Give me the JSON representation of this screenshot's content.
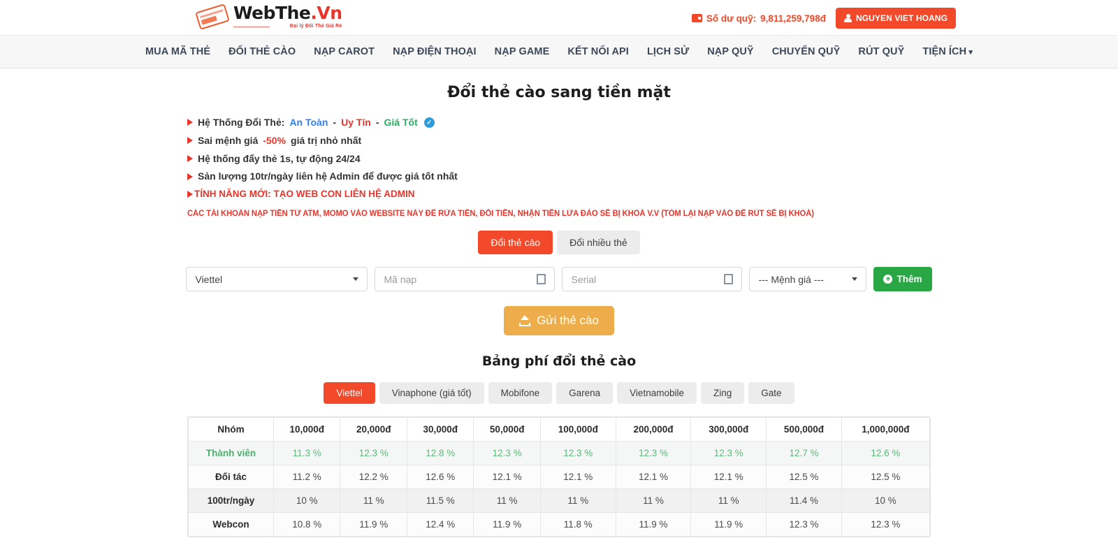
{
  "header": {
    "logo": {
      "main_a": "WebThe",
      "main_b": ".Vn",
      "sub": "Đại lý Đổi Thẻ Giá Rẻ",
      "badge": "WebThe"
    },
    "balance_label": "Số dư quỹ:",
    "balance_amount": "9,811,259,798đ",
    "user_name": "NGUYEN VIET HOANG"
  },
  "nav": {
    "items": [
      {
        "label": "MUA MÃ THẺ",
        "caret": false
      },
      {
        "label": "ĐỔI THẺ CÀO",
        "caret": false
      },
      {
        "label": "NẠP CAROT",
        "caret": false
      },
      {
        "label": "NẠP ĐIỆN THOẠI",
        "caret": false
      },
      {
        "label": "NẠP GAME",
        "caret": false
      },
      {
        "label": "KẾT NỐI API",
        "caret": false
      },
      {
        "label": "LỊCH SỬ",
        "caret": false
      },
      {
        "label": "NẠP QUỸ",
        "caret": false
      },
      {
        "label": "CHUYỂN QUỸ",
        "caret": false
      },
      {
        "label": "RÚT QUỸ",
        "caret": false
      },
      {
        "label": "TIỆN ÍCH",
        "caret": true
      }
    ]
  },
  "main": {
    "page_title": "Đổi thẻ cào sang tiền mặt",
    "bullets": [
      {
        "prefix": "Hệ Thống Đổi Thẻ:",
        "blue": "An Toàn",
        "sep1": "-",
        "red": "Uy Tín",
        "sep2": "-",
        "green": "Giá Tốt",
        "verified": true
      },
      {
        "prefix": "Sai mệnh giá",
        "red": "-50%",
        "suffix": "giá trị nhỏ nhất"
      },
      {
        "prefix": "Hệ thống đẩy thẻ 1s, tự động 24/24"
      },
      {
        "prefix": "Sản lượng 10tr/ngày liên hệ Admin để được giá tốt nhất"
      }
    ],
    "promo": "TÍNH NĂNG MỚI: TẠO WEB CON LIÊN HỆ ADMIN",
    "warning": "CÁC TÀI KHOẢN NẠP TIỀN TỪ ATM, MOMO VÀO WEBSITE NÀY ĐỂ RỬA TIỀN, ĐỔI TIỀN, NHẬN TIỀN LỪA ĐẢO SẼ BỊ KHOÁ V.V (TÓM LẠI NẠP VÀO ĐỂ RÚT SẼ BỊ KHOÁ)",
    "mode_tabs": [
      {
        "label": "Đổi thẻ cào",
        "active": true
      },
      {
        "label": "Đổi nhiều thẻ",
        "active": false
      }
    ],
    "form": {
      "network_value": "Viettel",
      "code_placeholder": "Mã nạp",
      "code_value": "",
      "serial_placeholder": "Serial",
      "serial_value": "",
      "denom_value": "--- Mệnh giá ---",
      "add_label": "Thêm",
      "submit_label": "Gửi thẻ cào"
    }
  },
  "fee_section": {
    "title": "Bảng phí đổi thẻ cào",
    "provider_tabs": [
      {
        "label": "Viettel",
        "active": true
      },
      {
        "label": "Vinaphone (giá tốt)",
        "active": false
      },
      {
        "label": "Mobifone",
        "active": false
      },
      {
        "label": "Garena",
        "active": false
      },
      {
        "label": "Vietnamobile",
        "active": false
      },
      {
        "label": "Zing",
        "active": false
      },
      {
        "label": "Gate",
        "active": false
      }
    ],
    "table": {
      "headers": [
        "Nhóm",
        "10,000đ",
        "20,000đ",
        "30,000đ",
        "50,000đ",
        "100,000đ",
        "200,000đ",
        "300,000đ",
        "500,000đ",
        "1,000,000đ"
      ],
      "rows": [
        {
          "group": "Thành viên",
          "values": [
            "11.3 %",
            "12.3 %",
            "12.8 %",
            "12.3 %",
            "12.3 %",
            "12.3 %",
            "12.3 %",
            "12.7 %",
            "12.6 %"
          ]
        },
        {
          "group": "Đối tác",
          "values": [
            "11.2 %",
            "12.2 %",
            "12.6 %",
            "12.1 %",
            "12.1 %",
            "12.1 %",
            "12.1 %",
            "12.5 %",
            "12.5 %"
          ]
        },
        {
          "group": "100tr/ngày",
          "values": [
            "10 %",
            "11 %",
            "11.5 %",
            "11 %",
            "11 %",
            "11 %",
            "11 %",
            "11.4 %",
            "10 %"
          ]
        },
        {
          "group": "Webcon",
          "values": [
            "10.8 %",
            "11.9 %",
            "12.4 %",
            "11.9 %",
            "11.8 %",
            "11.9 %",
            "11.9 %",
            "12.3 %",
            "12.3 %"
          ]
        }
      ]
    }
  },
  "colors": {
    "brand_orange": "#f2492a",
    "green": "#29a745",
    "amber": "#edad4a",
    "red_text": "#e8352b"
  }
}
